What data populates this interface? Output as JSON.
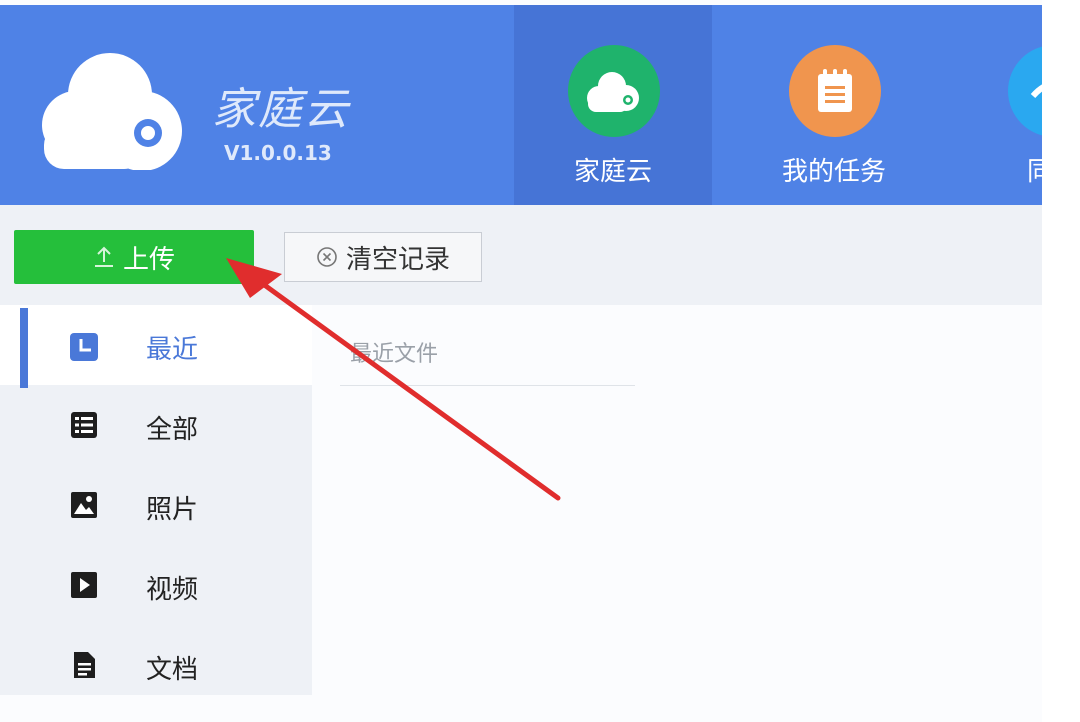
{
  "app": {
    "name": "家庭云",
    "version": "V1.0.0.13"
  },
  "nav": {
    "tabs": [
      {
        "label": "家庭云",
        "icon": "cloud-icon",
        "color": "#1fb36c"
      },
      {
        "label": "我的任务",
        "icon": "notepad-icon",
        "color": "#f0954e"
      },
      {
        "label": "同步",
        "icon": "sync-icon",
        "color": "#2aa8f0"
      }
    ]
  },
  "toolbar": {
    "upload_icon": "upload-arrow-icon",
    "upload_label": "上传",
    "clear_icon": "close-circle-icon",
    "clear_label": "清空记录"
  },
  "sidebar": {
    "items": [
      {
        "label": "最近",
        "icon": "recent-clock-icon"
      },
      {
        "label": "全部",
        "icon": "list-icon"
      },
      {
        "label": "照片",
        "icon": "image-icon"
      },
      {
        "label": "视频",
        "icon": "video-play-icon"
      },
      {
        "label": "文档",
        "icon": "document-icon"
      }
    ]
  },
  "main": {
    "heading": "最近文件"
  },
  "colors": {
    "header": "#4f82e6",
    "upload_button": "#25bf3b",
    "accent": "#4a78d8",
    "annotation_arrow": "#e02d2d"
  }
}
